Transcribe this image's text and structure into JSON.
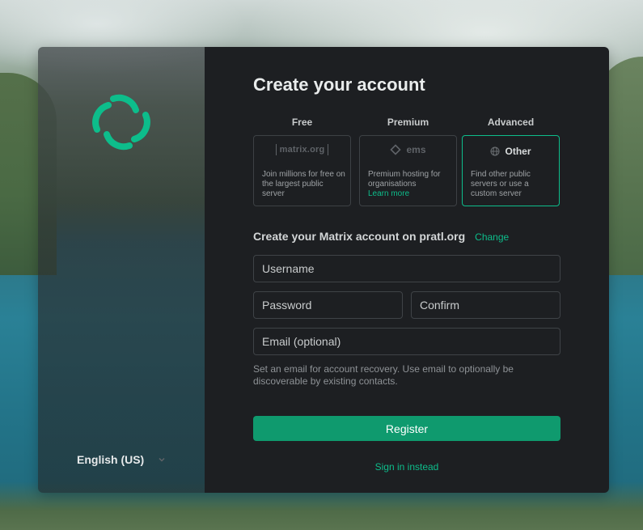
{
  "title": "Create your account",
  "tiers": [
    {
      "header": "Free",
      "logo_text": "matrix.org",
      "description": "Join millions for free on the largest public server",
      "link": ""
    },
    {
      "header": "Premium",
      "logo_text": "ems",
      "description": "Premium hosting for organisations",
      "link": "Learn more"
    },
    {
      "header": "Advanced",
      "logo_text": "Other",
      "description": "Find other public servers or use a custom server",
      "link": ""
    }
  ],
  "server": {
    "text": "Create your Matrix account on pratl.org",
    "change_label": "Change"
  },
  "fields": {
    "username_placeholder": "Username",
    "password_placeholder": "Password",
    "confirm_placeholder": "Confirm",
    "email_placeholder": "Email (optional)"
  },
  "email_hint": "Set an email for account recovery. Use email to optionally be discoverable by existing contacts.",
  "register_label": "Register",
  "signin_label": "Sign in instead",
  "language": "English (US)",
  "colors": {
    "accent": "#0dbd8b",
    "button": "#0f9a6e",
    "panel_bg": "#1d1f22"
  },
  "icons": {
    "logo": "element-logo-icon",
    "ems": "ems-logo-icon",
    "other": "globe-icon",
    "language_dropdown": "chevron-down-icon"
  }
}
